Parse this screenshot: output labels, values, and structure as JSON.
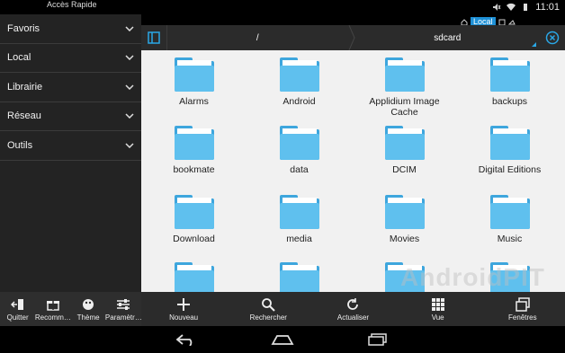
{
  "status": {
    "time": "11:01"
  },
  "location": {
    "label": "Local"
  },
  "sidebar": {
    "title": "Accès Rapide",
    "items": [
      {
        "label": "Favoris"
      },
      {
        "label": "Local"
      },
      {
        "label": "Librairie"
      },
      {
        "label": "Réseau"
      },
      {
        "label": "Outils"
      }
    ],
    "tools": [
      {
        "label": "Quitter",
        "icon": "exit-icon"
      },
      {
        "label": "Recomm…",
        "icon": "gift-icon"
      },
      {
        "label": "Thème",
        "icon": "palette-icon"
      },
      {
        "label": "Paramètr…",
        "icon": "sliders-icon"
      }
    ]
  },
  "breadcrumb": {
    "root": "/",
    "current": "sdcard"
  },
  "folders": [
    "Alarms",
    "Android",
    "Applidium Image Cache",
    "backups",
    "bookmate",
    "data",
    "DCIM",
    "Digital Editions",
    "Download",
    "media",
    "Movies",
    "Music",
    "",
    "",
    "",
    ""
  ],
  "watermark": "AndroidPIT",
  "actions": [
    {
      "label": "Nouveau",
      "icon": "plus-icon"
    },
    {
      "label": "Rechercher",
      "icon": "search-icon"
    },
    {
      "label": "Actualiser",
      "icon": "refresh-icon"
    },
    {
      "label": "Vue",
      "icon": "grid-view-icon"
    },
    {
      "label": "Fenêtres",
      "icon": "windows-icon"
    }
  ],
  "colors": {
    "accent": "#2aa7e6",
    "folder": "#5fc0ee",
    "folder_dark": "#3ea6dd",
    "panel": "#232323"
  }
}
